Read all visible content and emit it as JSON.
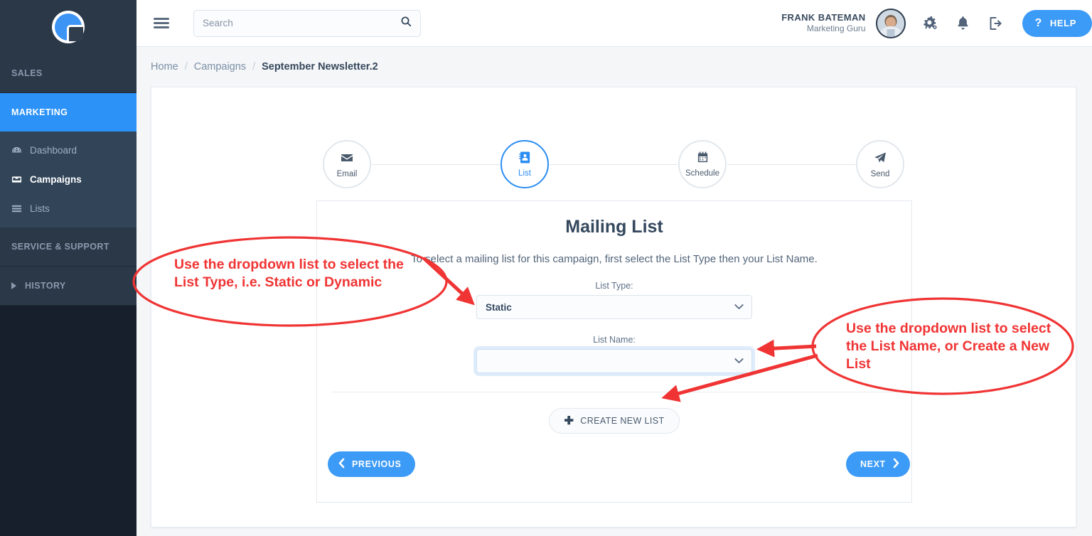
{
  "app": {
    "logo_name": "brand-logo"
  },
  "sidebar": {
    "sections": [
      {
        "label": "SALES",
        "active": false
      },
      {
        "label": "MARKETING",
        "active": true
      },
      {
        "label": "SERVICE & SUPPORT",
        "active": false
      },
      {
        "label": "HISTORY",
        "active": false
      }
    ],
    "marketing_items": [
      {
        "label": "Dashboard",
        "icon": "dashboard-icon",
        "current": false
      },
      {
        "label": "Campaigns",
        "icon": "inbox-icon",
        "current": true
      },
      {
        "label": "Lists",
        "icon": "list-icon",
        "current": false
      }
    ]
  },
  "topbar": {
    "menu_icon": "hamburger-icon",
    "search": {
      "value": "",
      "placeholder": "Search",
      "icon": "search-icon"
    },
    "user": {
      "name": "FRANK BATEMAN",
      "role": "Marketing Guru",
      "avatar": "user-avatar"
    },
    "icons": [
      "settings-gears-icon",
      "notifications-bell-icon",
      "logout-icon"
    ],
    "help": {
      "label": "HELP",
      "glyph": "?",
      "color": "#3c9bf7"
    }
  },
  "breadcrumb": {
    "items": [
      "Home",
      "Campaigns",
      "September Newsletter.2"
    ],
    "separator": "/"
  },
  "wizard": {
    "steps": [
      {
        "label": "Email",
        "icon": "envelope-icon",
        "active": false
      },
      {
        "label": "List",
        "icon": "contact-card-icon",
        "active": true
      },
      {
        "label": "Schedule",
        "icon": "calendar-icon",
        "active": false
      },
      {
        "label": "Send",
        "icon": "paper-plane-icon",
        "active": false
      }
    ],
    "active_color": "#2b8df3"
  },
  "panel": {
    "title": "Mailing List",
    "subtitle": "To select a mailing list for this campaign, first select the List Type then your List Name.",
    "list_type": {
      "label": "List Type:",
      "value": "Static",
      "options": [
        "Static",
        "Dynamic"
      ],
      "chevron": "chevron-down-icon"
    },
    "list_name": {
      "label": "List Name:",
      "value": "",
      "options": [],
      "chevron": "chevron-down-icon"
    },
    "create_button": {
      "label": "CREATE NEW LIST",
      "icon": "plus-icon"
    }
  },
  "footer": {
    "previous": {
      "label": "PREVIOUS",
      "icon": "chevron-left-icon"
    },
    "next": {
      "label": "NEXT",
      "icon": "chevron-right-icon"
    }
  },
  "annotations": {
    "color": "#f03434",
    "callout_1": "Use the dropdown list to select the List Type, i.e. Static or Dynamic",
    "callout_2": "Use the dropdown list to select the List Name, or Create a New List"
  }
}
